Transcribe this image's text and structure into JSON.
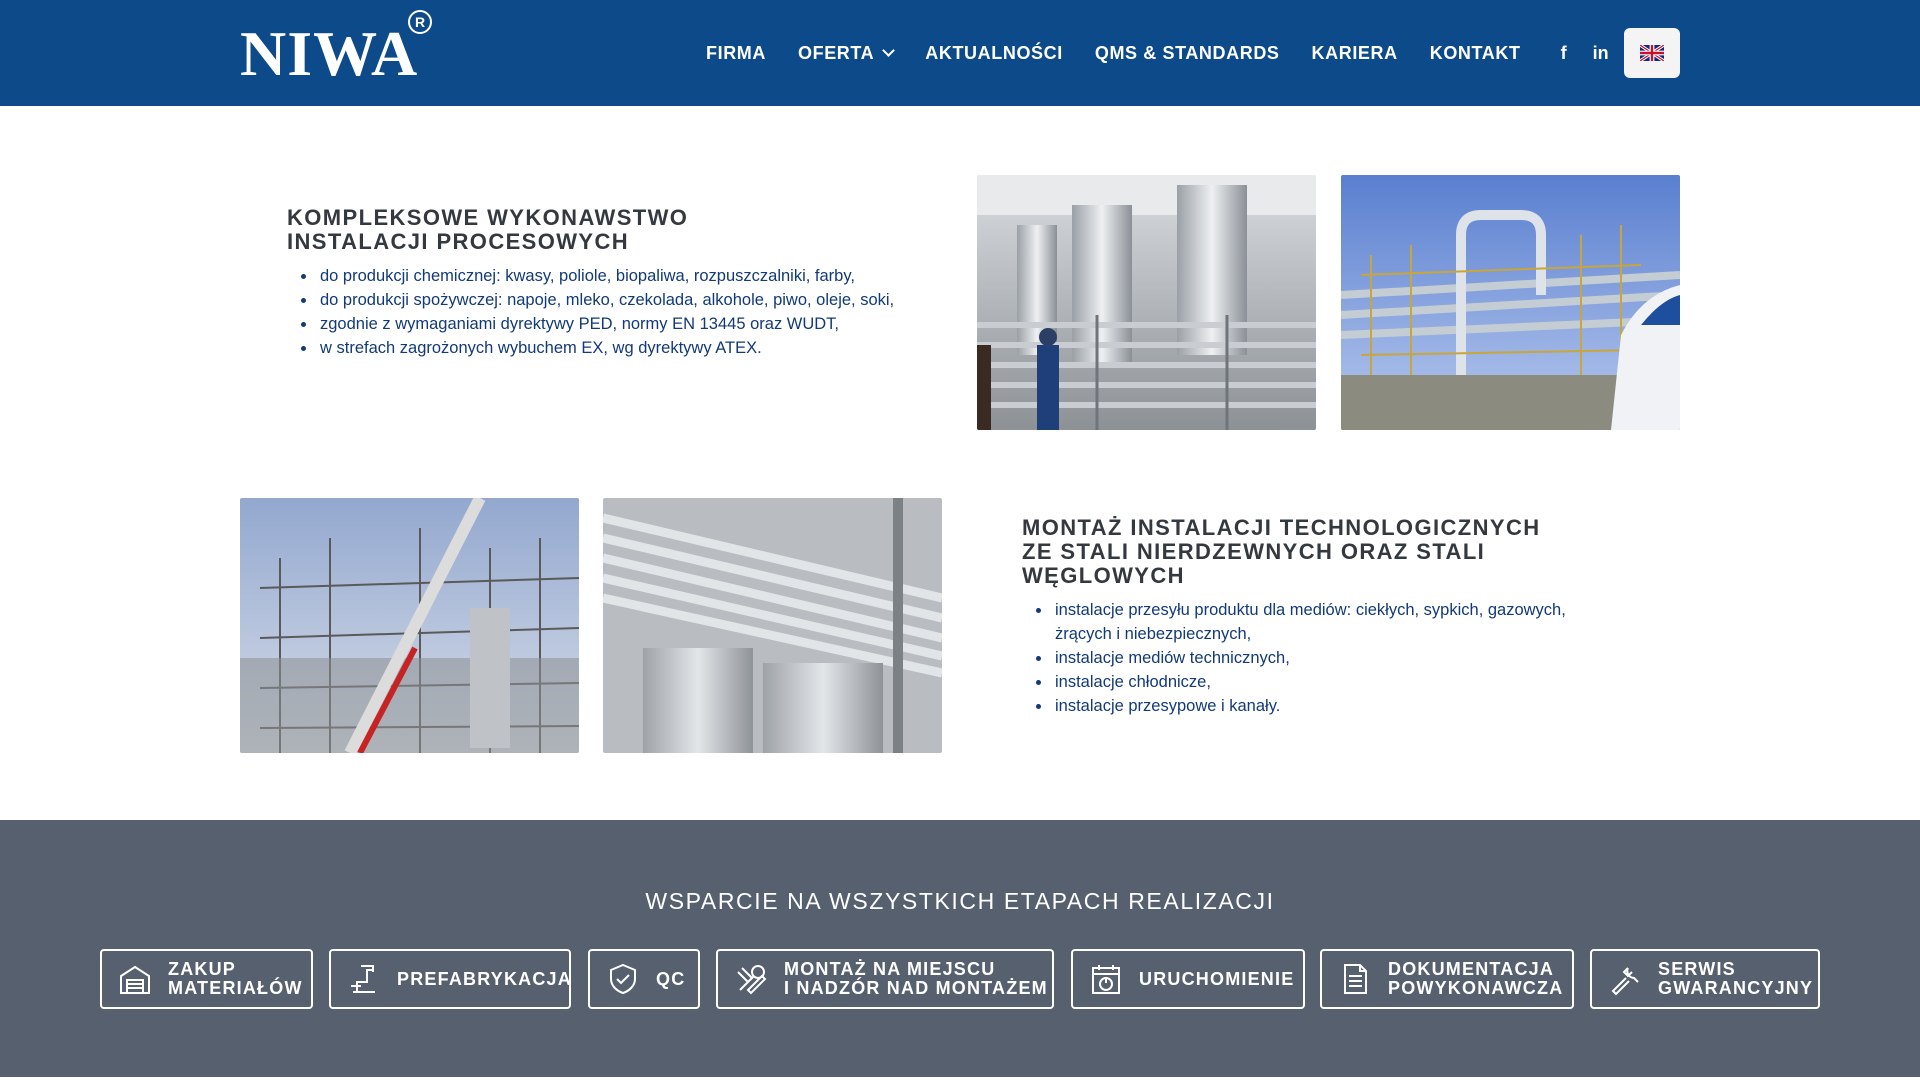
{
  "brand": {
    "name": "NIWA",
    "reg": "R"
  },
  "nav": {
    "items": [
      "FIRMA",
      "OFERTA",
      "AKTUALNOŚCI",
      "QMS & STANDARDS",
      "KARIERA",
      "KONTAKT"
    ],
    "facebook": "f",
    "linkedin": "in",
    "language": "English (UK flag)"
  },
  "section1": {
    "title_line1": "KOMPLEKSOWE WYKONAWSTWO",
    "title_line2": "INSTALACJI PROCESOWYCH",
    "bullets": [
      "do produkcji chemicznej: kwasy, poliole, biopaliwa, rozpuszczalniki, farby,",
      "do produkcji spożywczej: napoje, mleko, czekolada, alkohole, piwo, oleje, soki,",
      "zgodnie z wymaganiami dyrektywy PED, normy EN 13445 oraz WUDT,",
      "w strefach zagrożonych wybuchem EX, wg dyrektywy ATEX."
    ]
  },
  "section2": {
    "title_line1": "MONTAŻ INSTALACJI TECHNOLOGICZNYCH",
    "title_line2": "ZE STALI NIERDZEWNYCH ORAZ STALI",
    "title_line3": "WĘGLOWYCH",
    "bullets": [
      "instalacje przesyłu produktu dla mediów: ciekłych, sypkich, gazowych, żrących i niebezpiecznych,",
      "instalacje mediów technicznych,",
      "instalacje chłodnicze,",
      "instalacje przesypowe i kanały."
    ]
  },
  "support": {
    "title": "WSPARCIE NA WSZYSTKICH ETAPACH REALIZACJI",
    "steps": [
      {
        "label": "ZAKUP\nMATERIAŁÓW",
        "icon": "warehouse-icon"
      },
      {
        "label": "PREFABRYKACJA",
        "icon": "pipe-icon"
      },
      {
        "label": "QC",
        "icon": "shield-check-icon"
      },
      {
        "label": "MONTAŻ NA MIEJSCU\nI NADZÓR NAD MONTAŻEM",
        "icon": "tools-icon"
      },
      {
        "label": "URUCHOMIENIE",
        "icon": "calendar-power-icon"
      },
      {
        "label": "DOKUMENTACJA\nPOWYKONAWCZA",
        "icon": "document-icon"
      },
      {
        "label": "SERWIS\nGWARANCYJNY",
        "icon": "wrench-icon"
      }
    ]
  },
  "colors": {
    "header": "#0d4a8a",
    "band": "#56606e",
    "bullet_text": "#123a78",
    "heading": "#33393f"
  }
}
